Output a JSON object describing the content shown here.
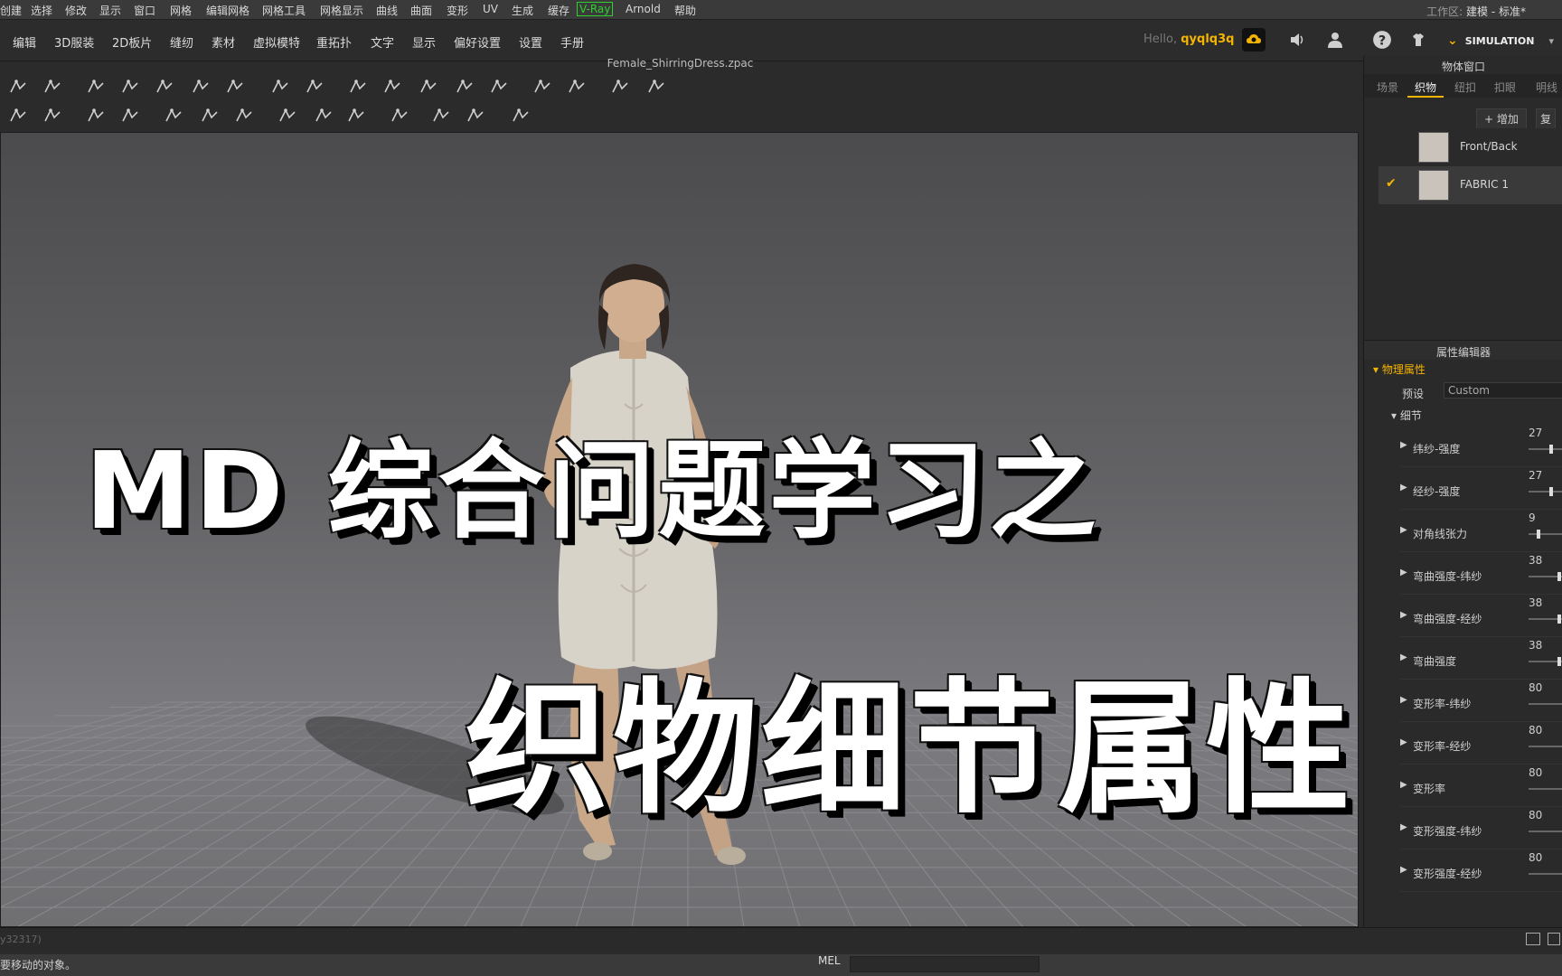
{
  "maya_menubar": {
    "items": [
      "创建",
      "选择",
      "修改",
      "显示",
      "窗口",
      "网格",
      "编辑网格",
      "网格工具",
      "网格显示",
      "曲线",
      "曲面",
      "变形",
      "UV",
      "生成",
      "缓存",
      "V-Ray",
      "Arnold",
      "帮助"
    ],
    "workspace_label": "工作区:",
    "workspace_value": "建模 - 标准*"
  },
  "md_menubar": {
    "items": [
      "编辑",
      "3D服装",
      "2D板片",
      "缝纫",
      "素材",
      "虚拟模特",
      "重拓扑",
      "文字",
      "显示",
      "偏好设置",
      "设置",
      "手册"
    ],
    "hello_prefix": "Hello,",
    "username": "qyqlq3q",
    "simulation_label": "SIMULATION"
  },
  "file_title": "Female_ShirringDress.zpac",
  "overlay": {
    "line1": "MD 综合问题学习之",
    "line2": "织物细节属性"
  },
  "object_window": {
    "title": "物体窗口",
    "tabs": [
      "场景",
      "织物",
      "纽扣",
      "扣眼",
      "明线"
    ],
    "active_tab": "织物",
    "add_label": "+ 增加",
    "copy_label": "复",
    "fabrics": [
      {
        "name": "Front/Back",
        "selected": false
      },
      {
        "name": "FABRIC 1",
        "selected": true
      }
    ]
  },
  "property_editor": {
    "title": "属性编辑器",
    "section": "物理属性",
    "preset_label": "预设",
    "preset_value": "Custom",
    "subsection": "细节",
    "properties": [
      {
        "name": "纬纱-强度",
        "value": "27",
        "level": 0.5
      },
      {
        "name": "经纱-强度",
        "value": "27",
        "level": 0.5
      },
      {
        "name": "对角线张力",
        "value": "9",
        "level": 0.2
      },
      {
        "name": "弯曲强度-纬纱",
        "value": "38",
        "level": 0.7
      },
      {
        "name": "弯曲强度-经纱",
        "value": "38",
        "level": 0.7
      },
      {
        "name": "弯曲强度",
        "value": "38",
        "level": 0.7
      },
      {
        "name": "变形率-纬纱",
        "value": "80",
        "level": 0.9
      },
      {
        "name": "变形率-经纱",
        "value": "80",
        "level": 0.9
      },
      {
        "name": "变形率",
        "value": "80",
        "level": 0.9
      },
      {
        "name": "变形强度-纬纱",
        "value": "80",
        "level": 0.9
      },
      {
        "name": "变形强度-经纱",
        "value": "80",
        "level": 0.9
      }
    ]
  },
  "bottom": {
    "command_hint": "y32317)",
    "help_text": "要移动的对象。",
    "mel_label": "MEL"
  },
  "colors": {
    "accent": "#f4b400",
    "vray": "#2fd12f",
    "viewport_top": "#4b4b4d",
    "viewport_bottom": "#7c7c80"
  }
}
